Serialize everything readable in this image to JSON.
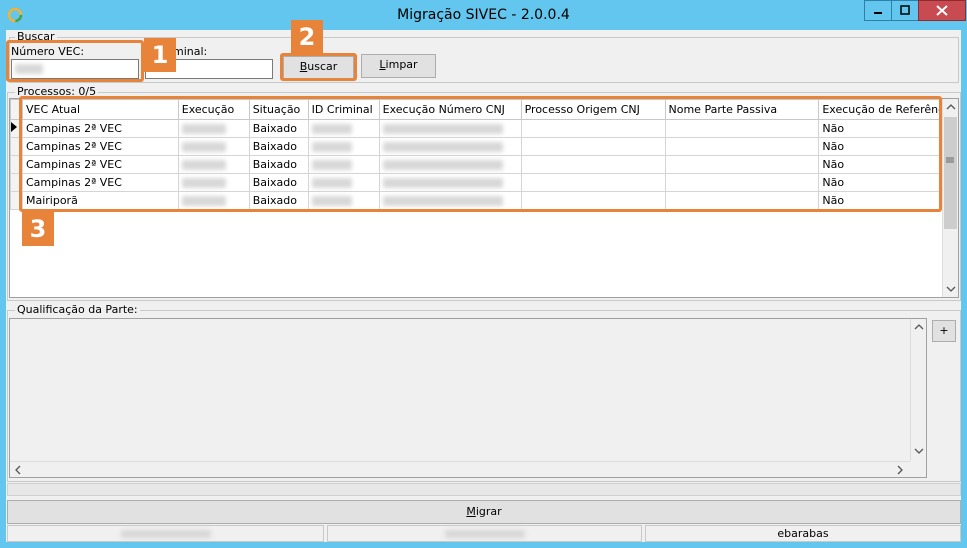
{
  "window": {
    "title": "Migração SIVEC - 2.0.0.4"
  },
  "search": {
    "group_label": "Buscar",
    "vec_label": "Número VEC:",
    "criminal_label": "minal:",
    "buscar_btn_a": "B",
    "buscar_btn_b": "uscar",
    "limpar_btn_a": "L",
    "limpar_btn_b": "impar"
  },
  "processes": {
    "group_label": "Processos: 0/5",
    "columns": [
      "VEC Atual",
      "Execução",
      "Situação",
      "ID Criminal",
      "Execução Número CNJ",
      "Processo Origem CNJ",
      "Nome Parte Passiva",
      "Execução de Referência"
    ],
    "rows": [
      {
        "vec": "Campinas 2ª VEC",
        "situacao": "Baixado",
        "referencia": "Não"
      },
      {
        "vec": "Campinas 2ª VEC",
        "situacao": "Baixado",
        "referencia": "Não"
      },
      {
        "vec": "Campinas 2ª VEC",
        "situacao": "Baixado",
        "referencia": "Não"
      },
      {
        "vec": "Campinas 2ª VEC",
        "situacao": "Baixado",
        "referencia": "Não"
      },
      {
        "vec": "Mairiporã",
        "situacao": "Baixado",
        "referencia": "Não"
      }
    ]
  },
  "qualification": {
    "group_label": "Qualificação da Parte:",
    "add_btn": "+"
  },
  "actions": {
    "migrar_a": "M",
    "migrar_b": "igrar"
  },
  "status": {
    "user": "ebarabas"
  },
  "callouts": [
    "1",
    "2",
    "3"
  ],
  "colors": {
    "titlebar": "#62c6ee",
    "close": "#c74b50",
    "callout": "#e8833a"
  }
}
